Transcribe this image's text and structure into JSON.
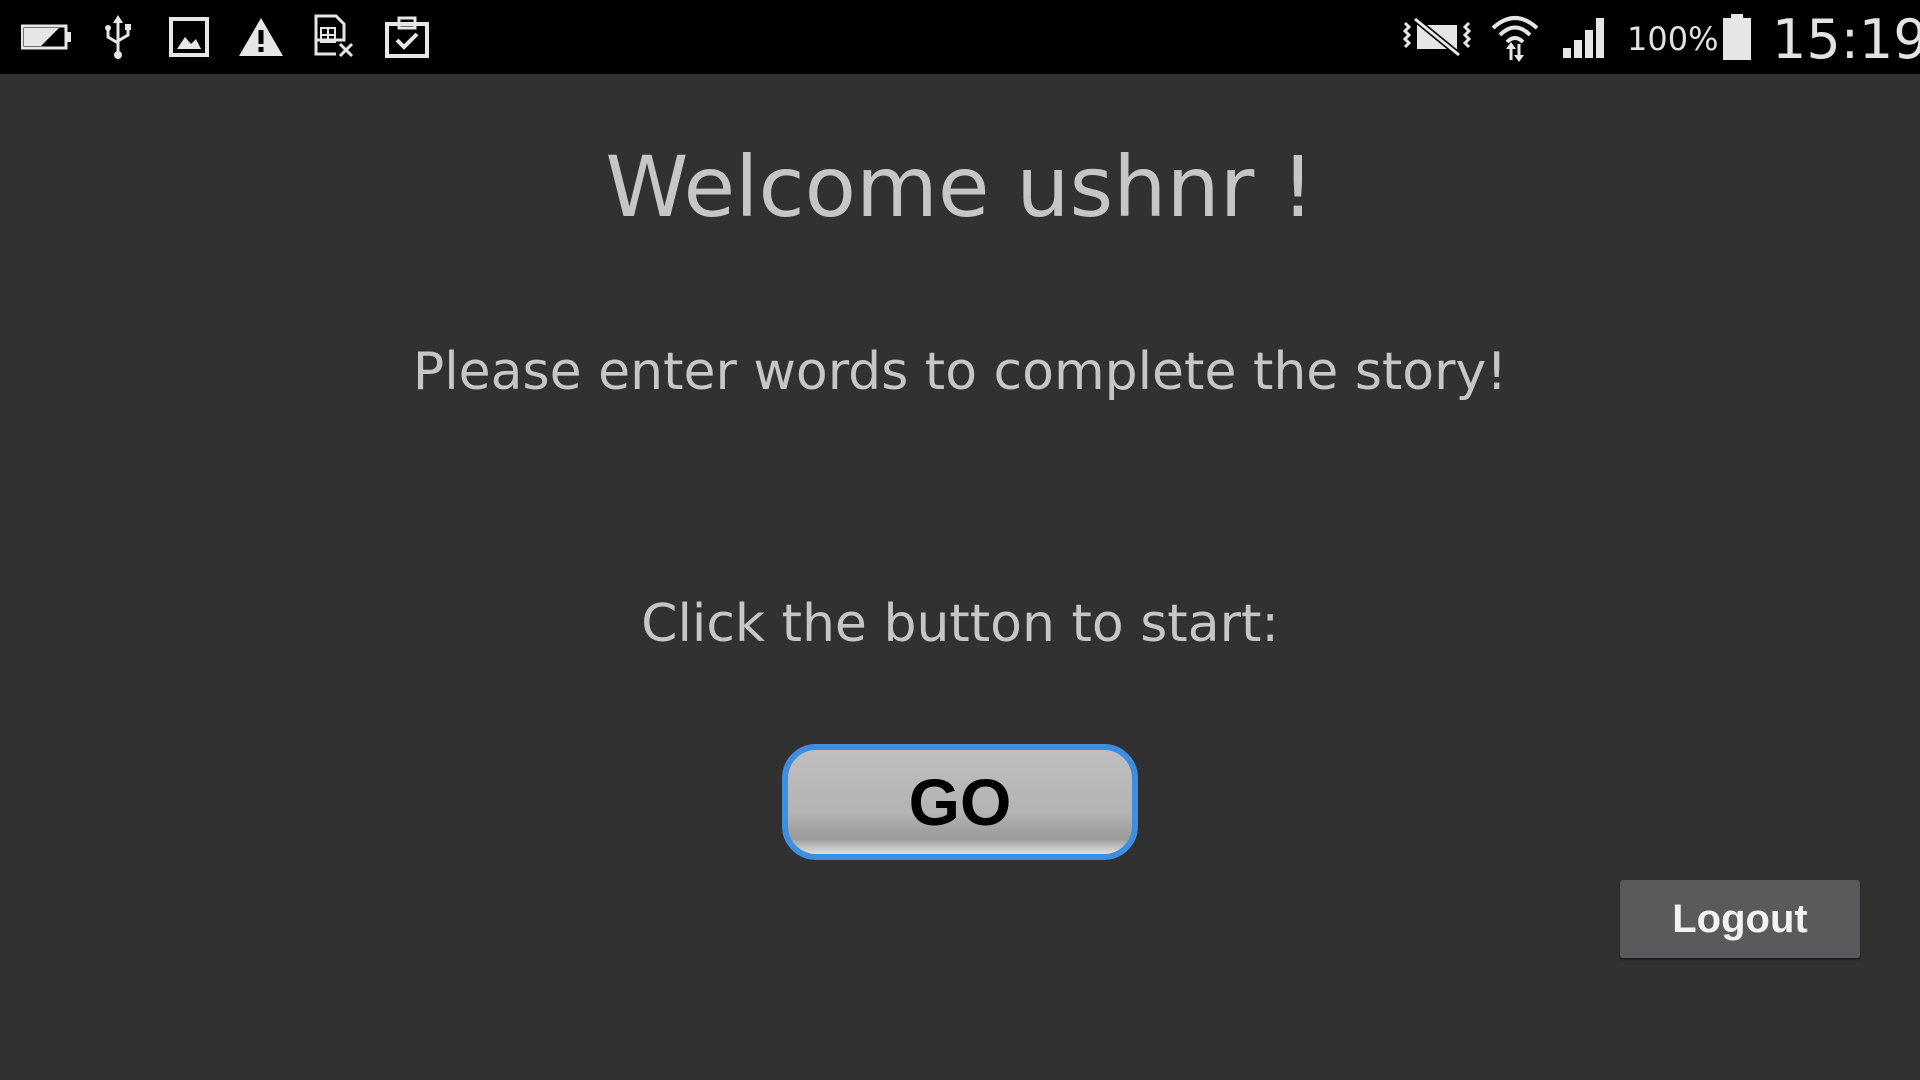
{
  "status_bar": {
    "left_icons": [
      "battery-low-icon",
      "usb-icon",
      "image-icon",
      "warning-icon",
      "sim-error-icon",
      "clipboard-check-icon"
    ],
    "right_icons": [
      "vibrate-mute-icon",
      "wifi-icon",
      "signal-icon",
      "battery-full-icon"
    ],
    "battery_percent": "100%",
    "time": "15:19"
  },
  "main": {
    "welcome": "Welcome ushnr !",
    "instruction": "Please enter words to complete the story!",
    "click_prompt": "Click the button to start:",
    "go_label": "GO",
    "logout_label": "Logout"
  },
  "colors": {
    "background": "#313131",
    "status_bar": "#000000",
    "text": "#c6c6c6",
    "go_border": "#3d8ee0",
    "logout_bg": "#5a5a5c"
  }
}
